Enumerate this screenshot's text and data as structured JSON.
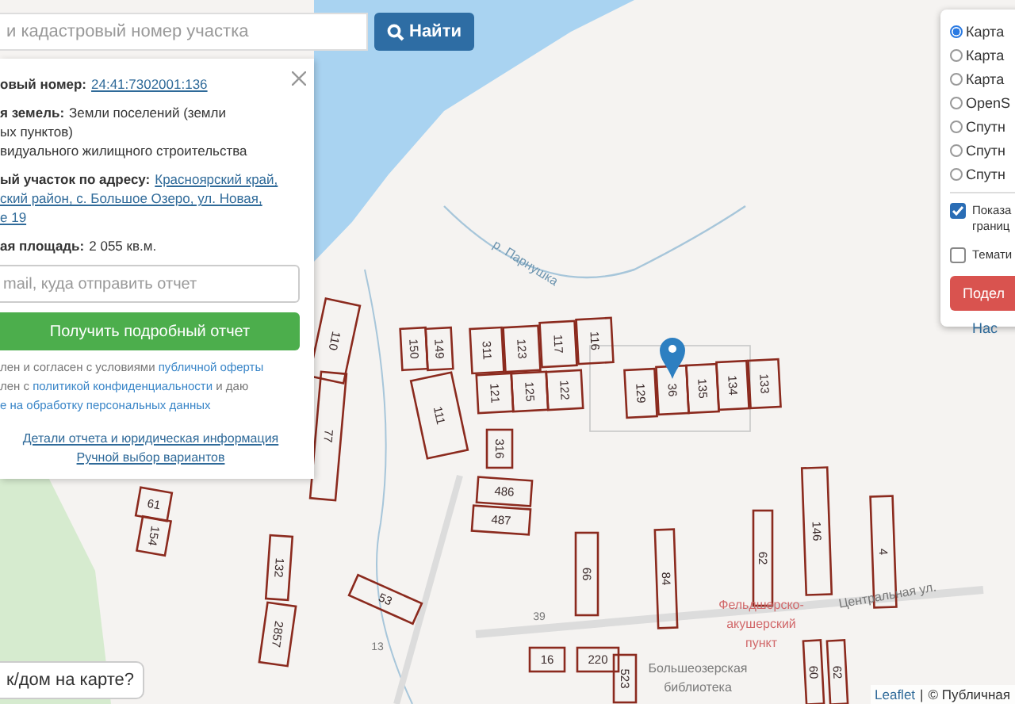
{
  "search": {
    "placeholder": "и кадастровый номер участка",
    "button": "Найти"
  },
  "info_panel": {
    "fields": [
      {
        "label": "овый номер:",
        "lines": [
          "24:41:7302001:136"
        ],
        "link": true
      },
      {
        "label": "я земель:",
        "lines": [
          "Земли поселений (земли",
          "ых пунктов)",
          "видуального жилищного строительства"
        ],
        "link": false
      },
      {
        "label": "ый участок по адресу:",
        "lines": [
          "Красноярский край,",
          "ский район, с. Большое Озеро, ул. Новая,",
          "е 19"
        ],
        "link": true
      },
      {
        "label": "ая площадь:",
        "lines": [
          "2 055 кв.м."
        ],
        "link": false
      }
    ],
    "email": {
      "placeholder": "mail, куда отправить отчет"
    },
    "report_button": "Получить подробный отчет",
    "consent": [
      [
        {
          "text": "лен и согласен с условиями ",
          "link": false
        },
        {
          "text": "публичной оферты",
          "link": true
        }
      ],
      [
        {
          "text": "лен с ",
          "link": false
        },
        {
          "text": "политикой конфиденциальности",
          "link": true
        },
        {
          "text": " и даю",
          "link": false
        }
      ],
      [
        {
          "text": "е на обработку персональных данных",
          "link": true
        }
      ]
    ],
    "links": [
      "Детали отчета и юридическая информация",
      "Ручной выбор вариантов"
    ]
  },
  "layers_panel": {
    "base_layers": [
      {
        "label": "Карта",
        "selected": true
      },
      {
        "label": "Карта",
        "selected": false
      },
      {
        "label": "Карта",
        "selected": false
      },
      {
        "label": "OpenS",
        "selected": false
      },
      {
        "label": "Спутн",
        "selected": false
      },
      {
        "label": "Спутн",
        "selected": false
      },
      {
        "label": "Спутн",
        "selected": false
      }
    ],
    "overlays": [
      {
        "lines": [
          "Показа",
          "границ"
        ],
        "checked": true
      },
      {
        "lines": [
          "Темати"
        ],
        "checked": false
      }
    ],
    "share_button": "Подел",
    "settings_link": "Нас"
  },
  "map": {
    "parcels": [
      "110",
      "77",
      "150",
      "149",
      "311",
      "123",
      "117",
      "116",
      "121",
      "125",
      "122",
      "111",
      "316",
      "486",
      "487",
      "129",
      "36",
      "135",
      "134",
      "133",
      "66",
      "84",
      "62",
      "146",
      "4",
      "53",
      "61",
      "154",
      "132",
      "2857",
      "16",
      "220",
      "523",
      "60",
      "62"
    ],
    "labels": [
      {
        "text": "р. Парнушка",
        "kind": "river"
      },
      {
        "text": "Центральная ул.",
        "kind": "street"
      },
      {
        "text": "Фельдшерско-",
        "kind": "poi"
      },
      {
        "text": "акушерский",
        "kind": "poi"
      },
      {
        "text": "пункт",
        "kind": "poi"
      },
      {
        "text": "Большеозерская",
        "kind": "building"
      },
      {
        "text": "библиотека",
        "kind": "building"
      },
      {
        "text": "39",
        "kind": "house"
      },
      {
        "text": "13",
        "kind": "house"
      }
    ]
  },
  "help_bubble": "к/дом на карте?",
  "attribution": {
    "link": "Leaflet",
    "separator": "|",
    "text": "© Публичная"
  }
}
